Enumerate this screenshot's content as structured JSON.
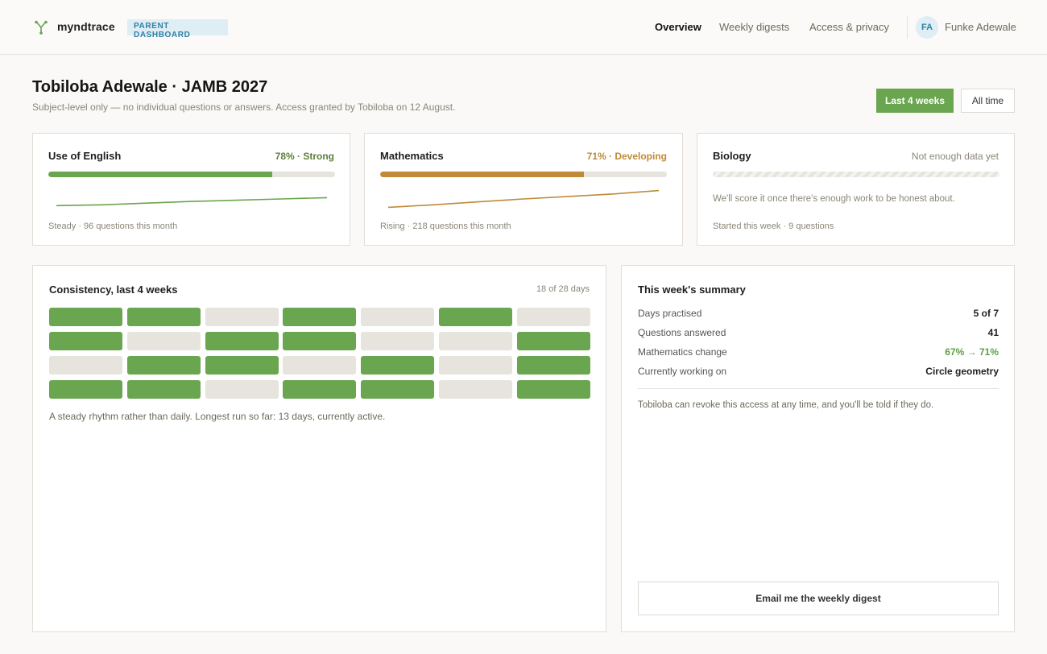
{
  "header": {
    "brand": "myndtrace",
    "badge": "PARENT DASHBOARD",
    "logo_icon": "branch-icon",
    "nav": [
      {
        "label": "Overview",
        "active": true
      },
      {
        "label": "Weekly digests",
        "active": false
      },
      {
        "label": "Access & privacy",
        "active": false
      }
    ],
    "user": {
      "initials": "FA",
      "name": "Funke Adewale"
    }
  },
  "page": {
    "title": "Tobiloba Adewale · JAMB 2027",
    "subtitle": "Subject-level only — no individual questions or answers. Access granted by Tobiloba on 12 August.",
    "range_buttons": [
      {
        "label": "Last 4 weeks",
        "active": true
      },
      {
        "label": "All time",
        "active": false
      }
    ]
  },
  "colors": {
    "accent_green": "#6aa54f",
    "accent_amber": "#c08a38",
    "track": "#e6e4dd"
  },
  "subjects": [
    {
      "name": "Use of English",
      "score_label": "78% · Strong",
      "progress": 0.78,
      "color": "#6aa54f",
      "score_color": "#5f7d3c",
      "trend": [
        0.18,
        0.22,
        0.3,
        0.38,
        0.44,
        0.5,
        0.56
      ],
      "footer": "Steady · 96 questions this month",
      "note": ""
    },
    {
      "name": "Mathematics",
      "score_label": "71% · Developing",
      "progress": 0.71,
      "color": "#c08a38",
      "score_color": "#c08a38",
      "trend": [
        0.1,
        0.22,
        0.36,
        0.5,
        0.62,
        0.74,
        0.9
      ],
      "footer": "Rising · 218 questions this month",
      "note": ""
    },
    {
      "name": "Biology",
      "score_label": "Not enough data yet",
      "progress": null,
      "color": "#e6e4dd",
      "score_color": "#8a8676",
      "trend": [],
      "footer": "Started this week · 9 questions",
      "note": "We'll score it once there's enough work to be honest about."
    }
  ],
  "consistency": {
    "title": "Consistency, last 4 weeks",
    "meta": "18 of 28 days",
    "weeks": [
      [
        1,
        1,
        0,
        1,
        0,
        1,
        0
      ],
      [
        1,
        0,
        1,
        1,
        0,
        0,
        1
      ],
      [
        0,
        1,
        1,
        0,
        1,
        0,
        1
      ],
      [
        1,
        1,
        0,
        1,
        1,
        0,
        1
      ]
    ],
    "note": "A steady rhythm rather than daily. Longest run so far: 13 days, currently active."
  },
  "summary": {
    "title": "This week's summary",
    "rows": [
      {
        "label": "Days practised",
        "value": "5 of 7",
        "green": false
      },
      {
        "label": "Questions answered",
        "value": "41",
        "green": false
      },
      {
        "label": "Mathematics change",
        "value": "67% → 71%",
        "green": true
      },
      {
        "label": "Currently working on",
        "value": "Circle geometry",
        "green": false
      }
    ],
    "note": "Tobiloba can revoke this access at any time, and you'll be told if they do.",
    "email_button": "Email me the weekly digest"
  }
}
